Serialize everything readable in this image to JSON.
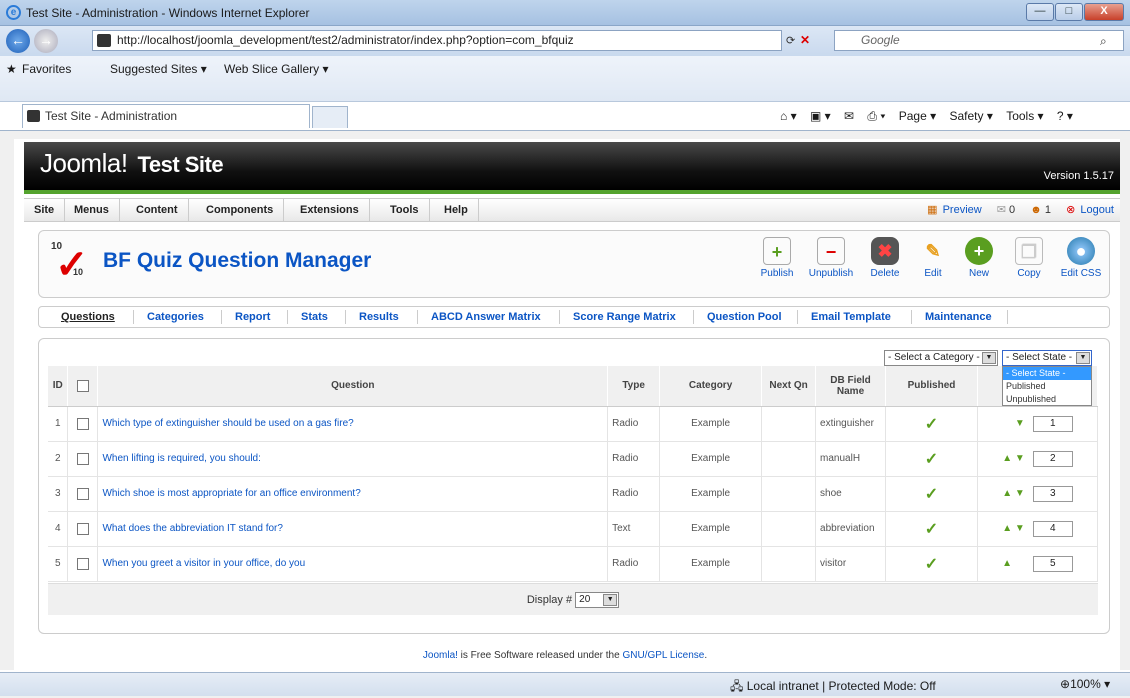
{
  "window": {
    "title": "Test Site - Administration - Windows Internet Explorer",
    "min": "—",
    "max": "□",
    "close": "X"
  },
  "address": {
    "url": "http://localhost/joomla_development/test2/administrator/index.php?option=com_bfquiz",
    "search_placeholder": "Google"
  },
  "favbar": {
    "favorites": "Favorites",
    "suggested": "Suggested Sites ▾",
    "webslice": "Web Slice Gallery ▾"
  },
  "tab": {
    "label": "Test Site - Administration"
  },
  "commands": {
    "page": "Page ▾",
    "safety": "Safety ▾",
    "tools": "Tools ▾"
  },
  "header": {
    "brand": "Joomla!",
    "site": "Test Site",
    "version": "Version 1.5.17"
  },
  "menu": [
    "Site",
    "Menus",
    "Content",
    "Components",
    "Extensions",
    "Tools",
    "Help"
  ],
  "rightmenu": {
    "preview": "Preview",
    "messages": "0",
    "users": "1",
    "logout": "Logout"
  },
  "page": {
    "title": "BF Quiz Question Manager",
    "icon_top": "10",
    "icon_bottom": "10"
  },
  "toolbar": [
    "Publish",
    "Unpublish",
    "Delete",
    "Edit",
    "New",
    "Copy",
    "Edit CSS"
  ],
  "submenu": [
    "Questions",
    "Categories",
    "Report",
    "Stats",
    "Results",
    "ABCD Answer Matrix",
    "Score Range Matrix",
    "Question Pool",
    "Email Template",
    "Maintenance"
  ],
  "filters": {
    "category": "- Select a Category -",
    "state": "- Select State -",
    "state_options": [
      "- Select State -",
      "Published",
      "Unpublished"
    ]
  },
  "table": {
    "headers": {
      "id": "ID",
      "question": "Question",
      "type": "Type",
      "category": "Category",
      "nextqn": "Next Qn",
      "dbfield": "DB Field Name",
      "published": "Published"
    },
    "rows": [
      {
        "id": "1",
        "question": "Which type of extinguisher should be used on a gas fire?",
        "type": "Radio",
        "category": "Example",
        "dbfield": "extinguisher",
        "order": "1"
      },
      {
        "id": "2",
        "question": "When lifting is required, you should:",
        "type": "Radio",
        "category": "Example",
        "dbfield": "manualH",
        "order": "2"
      },
      {
        "id": "3",
        "question": "Which shoe is most appropriate for an office environment?",
        "type": "Radio",
        "category": "Example",
        "dbfield": "shoe",
        "order": "3"
      },
      {
        "id": "4",
        "question": "What does the abbreviation IT stand for?",
        "type": "Text",
        "category": "Example",
        "dbfield": "abbreviation",
        "order": "4"
      },
      {
        "id": "5",
        "question": "When you greet a visitor in your office, do you",
        "type": "Radio",
        "category": "Example",
        "dbfield": "visitor",
        "order": "5"
      }
    ],
    "display_label": "Display #",
    "display_value": "20"
  },
  "footer": {
    "joomla": "Joomla!",
    "text": " is Free Software released under the ",
    "license": "GNU/GPL License",
    "dot": "."
  },
  "status": {
    "zone": "Local intranet | Protected Mode: Off",
    "zoom": "100%"
  }
}
